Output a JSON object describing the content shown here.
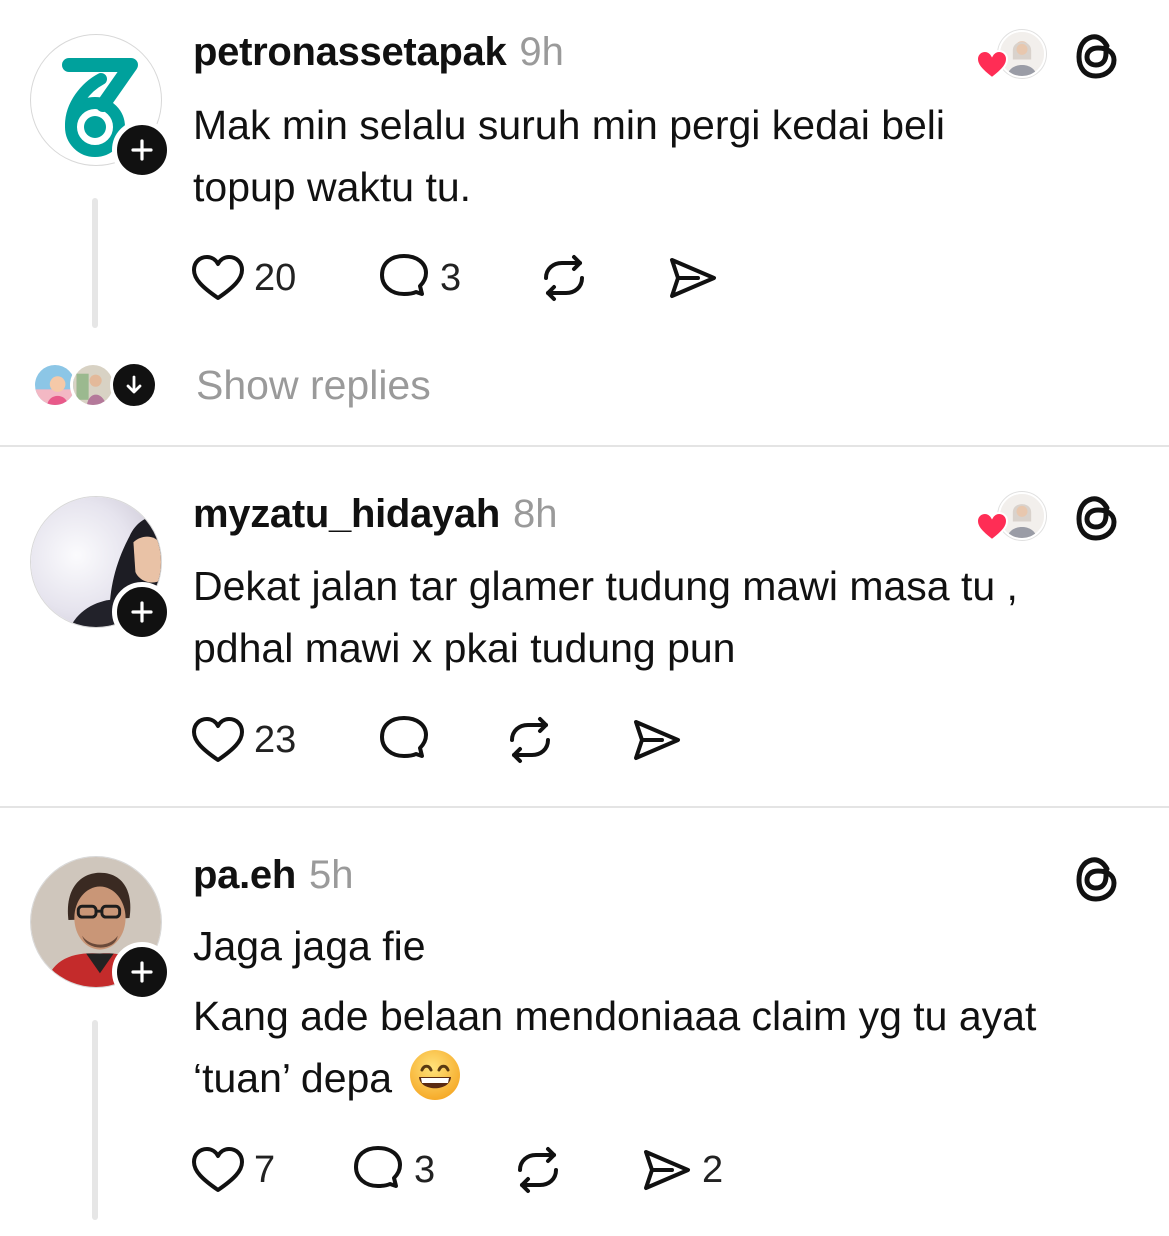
{
  "posts": [
    {
      "username": "petronassetapak",
      "time": "9h",
      "lines": [
        "Mak min selalu suruh min pergi kedai beli",
        "topup waktu tu."
      ],
      "likes": "20",
      "comments": "3",
      "reposts": "",
      "shares": "",
      "liked_by_author": true
    },
    {
      "username": "myzatu_hidayah",
      "time": "8h",
      "lines": [
        "Dekat jalan tar glamer tudung mawi masa tu ,",
        "pdhal mawi x pkai tudung pun"
      ],
      "likes": "23",
      "comments": "",
      "reposts": "",
      "shares": "",
      "liked_by_author": true
    },
    {
      "username": "pa.eh",
      "time": "5h",
      "lines": [
        "Jaga jaga fie",
        "Kang ade belaan mendoniaaa claim yg tu ayat",
        "‘tuan’ depa"
      ],
      "emoji": "grinning-face-emoji",
      "likes": "7",
      "comments": "3",
      "reposts": "",
      "shares": "2",
      "liked_by_author": false
    }
  ],
  "show_replies_label": "Show replies",
  "colors": {
    "heart_red": "#ff2d55",
    "petronas_teal": "#00a19c",
    "muted_text": "#9a9a9a",
    "divider": "#e4e4e4"
  },
  "icons": [
    "heart-icon",
    "comment-icon",
    "repost-icon",
    "share-icon",
    "threads-logo-icon",
    "follow-plus-icon",
    "arrow-down-icon"
  ]
}
